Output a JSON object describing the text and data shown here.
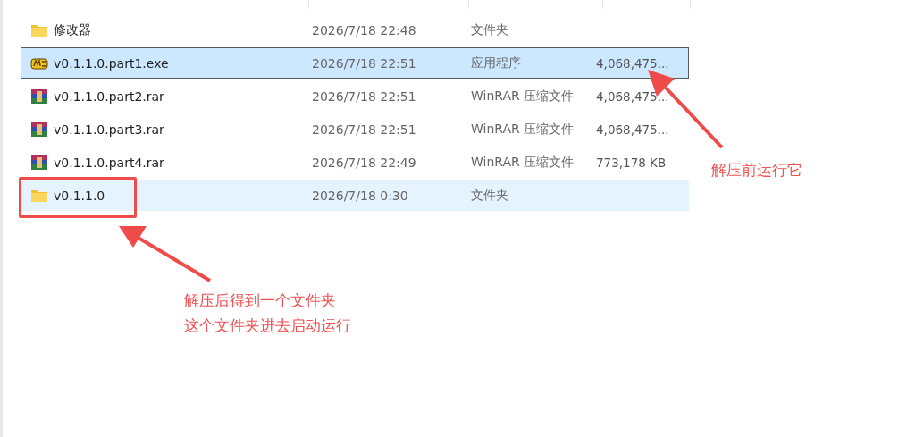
{
  "files": [
    {
      "kind": "folder",
      "name": "修改器",
      "date": "2026/7/18 22:48",
      "type": "文件夹",
      "selected": false,
      "hovered": false
    },
    {
      "kind": "exe",
      "name": "v0.1.1.0.part1.exe",
      "date": "2026/7/18 22:51",
      "type": "应用程序",
      "size": "4,068,475...",
      "selected": true,
      "hovered": false
    },
    {
      "kind": "rar",
      "name": "v0.1.1.0.part2.rar",
      "date": "2026/7/18 22:51",
      "type": "WinRAR 压缩文件",
      "size": "4,068,475...",
      "selected": false,
      "hovered": false
    },
    {
      "kind": "rar",
      "name": "v0.1.1.0.part3.rar",
      "date": "2026/7/18 22:51",
      "type": "WinRAR 压缩文件",
      "size": "4,068,475...",
      "selected": false,
      "hovered": false
    },
    {
      "kind": "rar",
      "name": "v0.1.1.0.part4.rar",
      "date": "2026/7/18 22:49",
      "type": "WinRAR 压缩文件",
      "size": "773,178 KB",
      "selected": false,
      "hovered": false
    },
    {
      "kind": "folder",
      "name": "v0.1.1.0",
      "date": "2026/7/18 0:30",
      "type": "文件夹",
      "selected": false,
      "hovered": true
    }
  ],
  "annotations": {
    "right_note": "解压前运行它",
    "bottom_note": [
      "解压后得到一个文件夹",
      "这个文件夹进去启动运行"
    ]
  }
}
